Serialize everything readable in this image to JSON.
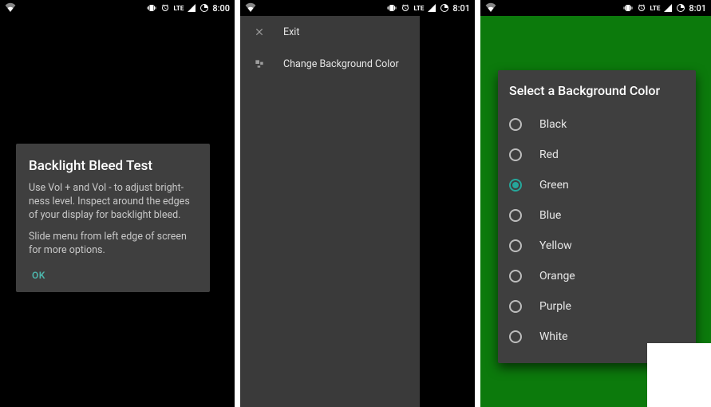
{
  "accent": "#26a69a",
  "screen3_bg": "#0c7a0c",
  "statusbar": {
    "time_a": "8:00",
    "time_b": "8:01"
  },
  "screen1": {
    "dialog": {
      "title": "Backlight Bleed Test",
      "body1": "Use Vol + and Vol - to adjust bright­ness level. Inspect around the edges of your display for backlight bleed.",
      "body2": "Slide menu from left edge of screen for more options.",
      "ok": "OK"
    }
  },
  "screen2": {
    "menu": {
      "exit": "Exit",
      "change_bg": "Change Background Color"
    }
  },
  "screen3": {
    "dialog": {
      "title": "Select a Background Color",
      "selected_index": 2,
      "options": [
        {
          "label": "Black"
        },
        {
          "label": "Red"
        },
        {
          "label": "Green"
        },
        {
          "label": "Blue"
        },
        {
          "label": "Yellow"
        },
        {
          "label": "Orange"
        },
        {
          "label": "Purple"
        },
        {
          "label": "White"
        }
      ]
    }
  }
}
